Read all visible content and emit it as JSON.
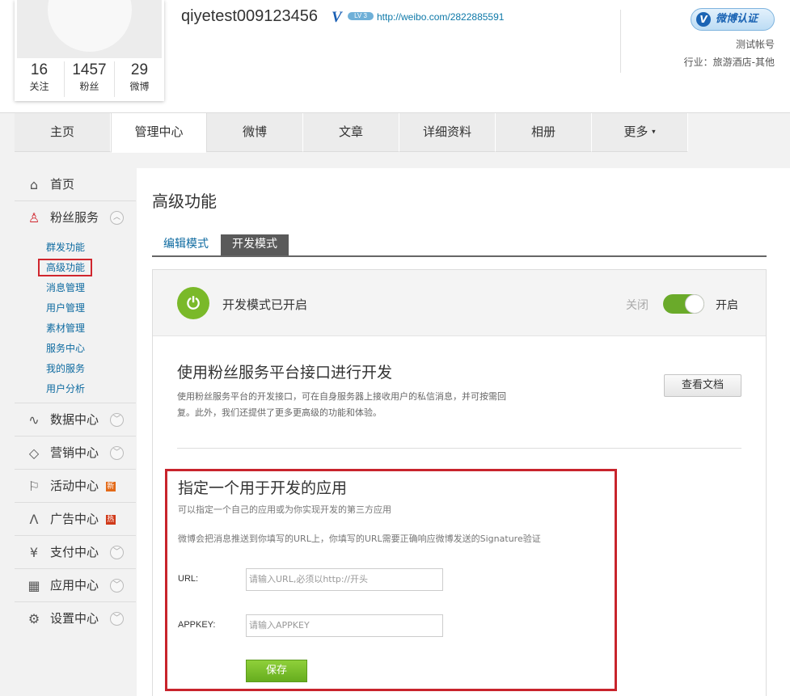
{
  "profile": {
    "username": "qiyetest009123456",
    "verified_mark": "V",
    "level_badge": "LV 3",
    "url": "http://weibo.com/2822885591",
    "stats": [
      {
        "num": "16",
        "label": "关注"
      },
      {
        "num": "1457",
        "label": "粉丝"
      },
      {
        "num": "29",
        "label": "微博"
      }
    ],
    "verify_badge": "微博认证",
    "verify_icon": "V",
    "account_type": "测试帐号",
    "industry": "行业：旅游酒店-其他"
  },
  "nav": {
    "tabs": [
      "主页",
      "管理中心",
      "微博",
      "文章",
      "详细资料",
      "相册",
      "更多"
    ],
    "active": "管理中心",
    "more_caret": "▾"
  },
  "sidebar": {
    "home": "首页",
    "fan_service": "粉丝服务",
    "sub_items": [
      "群发功能",
      "高级功能",
      "消息管理",
      "用户管理",
      "素材管理",
      "服务中心",
      "我的服务",
      "用户分析"
    ],
    "active_sub": "高级功能",
    "sections": [
      {
        "label": "数据中心",
        "icon": "chart-icon"
      },
      {
        "label": "营销中心",
        "icon": "bag-icon"
      },
      {
        "label": "活动中心",
        "icon": "flag-icon",
        "badge": "新"
      },
      {
        "label": "广告中心",
        "icon": "ad-icon",
        "badge": "热"
      },
      {
        "label": "支付中心",
        "icon": "yen-icon"
      },
      {
        "label": "应用中心",
        "icon": "grid-icon"
      },
      {
        "label": "设置中心",
        "icon": "user-gear-icon"
      }
    ]
  },
  "main": {
    "title": "高级功能",
    "mode_tabs": {
      "edit": "编辑模式",
      "dev": "开发模式"
    },
    "dev_status": "开发模式已开启",
    "toggle": {
      "off": "关闭",
      "on": "开启",
      "state": "on"
    },
    "section_title": "使用粉丝服务平台接口进行开发",
    "section_desc": "使用粉丝服务平台的开发接口，可在自身服务器上接收用户的私信消息，并可按需回复。此外，我们还提供了更多更高级的功能和体验。",
    "doc_button": "查看文档",
    "app": {
      "title": "指定一个用于开发的应用",
      "subtitle": "可以指定一个自己的应用或为你实现开发的第三方应用",
      "note": "微博会把消息推送到你填写的URL上，你填写的URL需要正确响应微博发送的Signature验证",
      "url_label": "URL:",
      "url_placeholder": "请输入URL,必须以http://开头",
      "appkey_label": "APPKEY:",
      "appkey_placeholder": "请输入APPKEY",
      "save": "保存"
    }
  },
  "colors": {
    "accent_green": "#7ab929",
    "link_blue": "#0d6aa0",
    "highlight_red": "#c8242c"
  }
}
